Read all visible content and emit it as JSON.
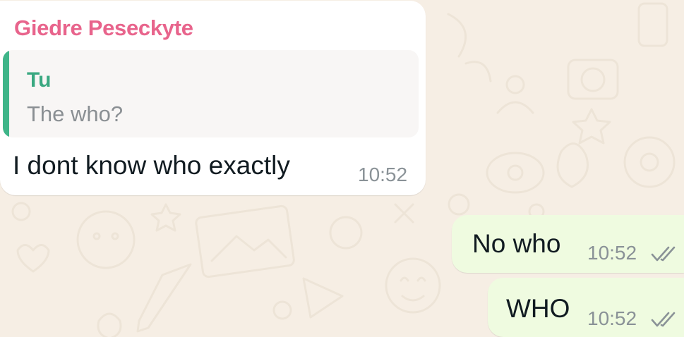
{
  "incoming_message": {
    "sender": "Giedre Peseckyte",
    "quoted": {
      "author": "Tu",
      "text": "The who?"
    },
    "text": "I dont know who exactly",
    "time": "10:52"
  },
  "outgoing_messages": [
    {
      "text": "No who",
      "time": "10:52",
      "status": "read"
    },
    {
      "text": "WHO",
      "time": "10:52",
      "status": "read"
    }
  ],
  "colors": {
    "sender_name": "#e8648c",
    "quote_accent": "#3fb589",
    "outgoing_bubble": "#effbe0",
    "incoming_bubble": "#ffffff",
    "wallpaper": "#f6eee4"
  }
}
